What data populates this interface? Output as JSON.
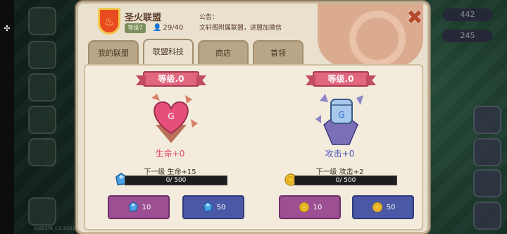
{
  "hud": {
    "right_values": [
      "442",
      "245"
    ],
    "build_id": "2182378_1.2.3(2123191)"
  },
  "alliance": {
    "name": "圣火联盟",
    "emblem_symbol": "♨",
    "level_chip": "等级7",
    "members": "29/40",
    "notice_title": "公告：",
    "notice_text": "文轩阁附属联盟，进盟加微信"
  },
  "tabs": [
    {
      "label": "我的联盟",
      "active": false
    },
    {
      "label": "联盟科技",
      "active": true
    },
    {
      "label": "商店",
      "active": false
    },
    {
      "label": "首领",
      "active": false
    }
  ],
  "techs": [
    {
      "level_label": "等级.0",
      "name": "生命+0",
      "name_color": "#e0436d",
      "art_icon": "heart-crystal-icon",
      "next_label": "下一级 生命+15",
      "progress_text": "0/ 500",
      "progress_ratio": 0,
      "resource_icon": "blue-gem-icon",
      "buttons": [
        {
          "amount": "10",
          "style": "purple"
        },
        {
          "amount": "50",
          "style": "blue"
        }
      ]
    },
    {
      "level_label": "等级.0",
      "name": "攻击+0",
      "name_color": "#4a55b8",
      "art_icon": "fist-crystal-icon",
      "next_label": "下一级 攻击+2",
      "progress_text": "0/ 500",
      "progress_ratio": 0,
      "resource_icon": "gold-coin-icon",
      "buttons": [
        {
          "amount": "10",
          "style": "purple"
        },
        {
          "amount": "50",
          "style": "blue"
        }
      ]
    }
  ]
}
